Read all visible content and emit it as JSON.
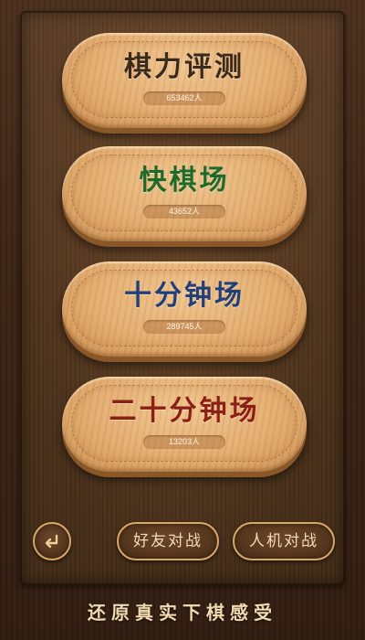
{
  "modes": [
    {
      "title": "棋力评测",
      "count": "653462人",
      "color": "#3a2a1c"
    },
    {
      "title": "快棋场",
      "count": "43652人",
      "color": "#1f6a2a"
    },
    {
      "title": "十分钟场",
      "count": "289745人",
      "color": "#223f7a"
    },
    {
      "title": "二十分钟场",
      "count": "13203人",
      "color": "#8a1f14"
    }
  ],
  "bottom": {
    "back_icon": "return-arrow-icon",
    "friend_label": "好友对战",
    "ai_label": "人机对战"
  },
  "slogan": "还原真实下棋感受"
}
